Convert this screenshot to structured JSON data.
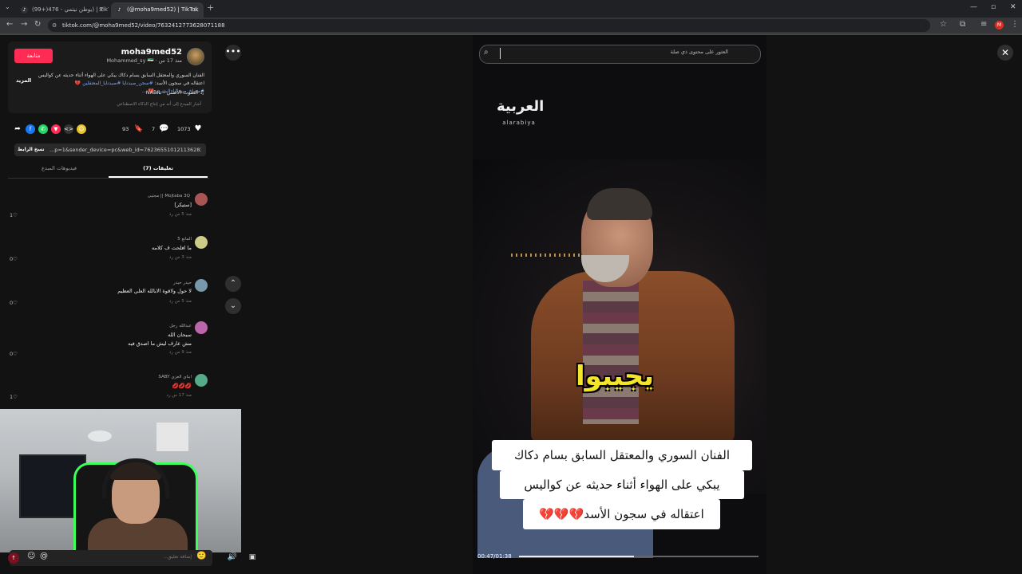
{
  "browser": {
    "tabs": [
      {
        "title": "(99+)يوطن نيتمي - 476) | TikTok",
        "favicon": "tiktok-icon"
      },
      {
        "title": "(@moha9med52) | TikTok",
        "favicon": "tiktok-icon"
      }
    ],
    "url": "tiktok.com/@moha9med52/video/7632412773628071188",
    "profile_initial": "M"
  },
  "post": {
    "follow_label": "متابعة",
    "username": "moha9med52",
    "subline": "Mohammed_sy 🇸🇾 · منذ 17 س",
    "description": "الفنان السوري والمعتقل السابق بسام دكاك يبكي على الهواء أثناء حديثه عن كواليس اعتقاله في سجون الأسد:",
    "hashtags": "#سجن_صيدنايا #صيدنايا_المعتقلين 💔 #مسلخ_صيدنايا_البشري 💔 ...",
    "more_label": "المزيد",
    "sound": "♫ الصوت الأصلي - NABIL",
    "ai_note": "أشار المبدع إلى أنه من إنتاج الذكاء الاصطناعي"
  },
  "actions": {
    "likes": "1073",
    "comments": "7",
    "saves": "93"
  },
  "share": {
    "link": "...p=1&sender_device=pc&web_id=7623655101211362836",
    "copy_label": "نسخ الرابط"
  },
  "tabs": {
    "comments": "تعليقات (7)",
    "creator_videos": "فيديوهات المبدع"
  },
  "comments": [
    {
      "name": "Mojtaba 3Q || مجتبى",
      "text": "[ستيكر]",
      "meta": "منذ 5 س   رد",
      "likes": "1"
    },
    {
      "name": "المانع 5",
      "text": "ما افلحت ف كلامه",
      "meta": "منذ 3 س   رد",
      "likes": "0"
    },
    {
      "name": "حيدر حيدر",
      "text": "لا حول ولاقوة الابالله العلي العظيم",
      "meta": "منذ 5 س   رد",
      "likes": "0"
    },
    {
      "name": "عبدالله رجل",
      "text": "سبحان الله\nمش عارف ليش ما اصدق فيه",
      "meta": "منذ 9 س   رد",
      "likes": "0"
    },
    {
      "name": "ابناي العزي SABY",
      "text": "💋💋💋",
      "meta": "منذ 17 س   رد",
      "likes": "1"
    }
  ],
  "input": {
    "placeholder": "إضافة تعليق..."
  },
  "search": {
    "placeholder": "العثور على محتوى ذي صلة"
  },
  "video": {
    "logo_ar": "العربية",
    "logo_en": "alarabiya",
    "subtitle": "يجيبوا",
    "caption_lines": [
      "الفنان السوري والمعتقل السابق بسام دكاك",
      "يبكي على الهواء أثناء حديثه عن كواليس",
      "اعتقاله في سجون الأسد💔💔💔"
    ],
    "time": "00:47/01:38",
    "progress": 0.48
  }
}
